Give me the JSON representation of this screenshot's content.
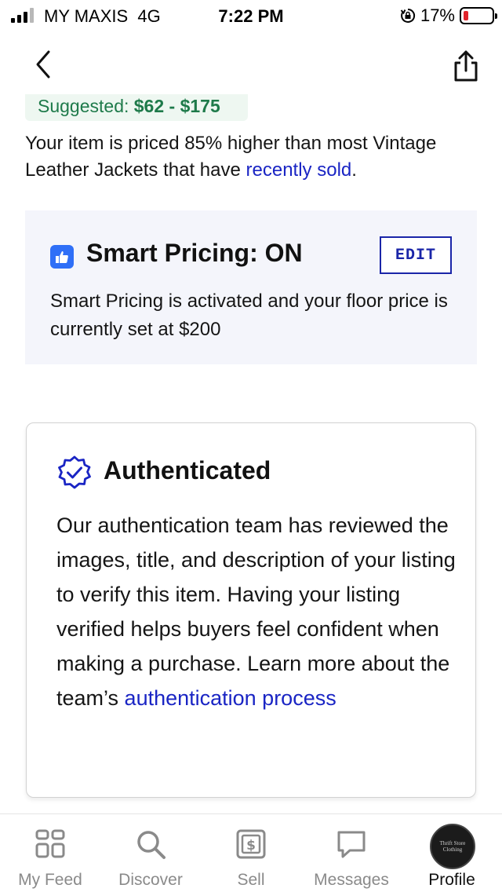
{
  "status_bar": {
    "carrier": "MY MAXIS",
    "network": "4G",
    "time": "7:22 PM",
    "battery": "17%",
    "battery_level": 0.17,
    "battery_color": "#e0242b"
  },
  "nav": {
    "back_icon": "chevron-left-icon",
    "share_icon": "share-icon"
  },
  "pricing": {
    "suggested_label": "Suggested: ",
    "suggested_range": "$62 - $175",
    "note_prefix": "Your item is priced 85% higher than most Vintage Leather Jackets that have ",
    "note_link": "recently sold",
    "note_suffix": "."
  },
  "smart_pricing": {
    "icon": "thumbs-up-icon",
    "title": "Smart Pricing: ON",
    "edit_label": "EDIT",
    "description": "Smart Pricing is activated and your floor price is currently set at $200"
  },
  "authenticated": {
    "icon": "verified-badge-icon",
    "title": "Authenticated",
    "body": "Our authentication team has reviewed the images, title, and description of your listing to verify this item. Having your listing verified helps buyers feel confident when making a purchase. Learn more about the team’s ",
    "link": "authentication process"
  },
  "tabbar": {
    "tabs": [
      {
        "label": "My Feed",
        "icon": "feed-grid-icon"
      },
      {
        "label": "Discover",
        "icon": "search-icon"
      },
      {
        "label": "Sell",
        "icon": "dollar-tag-icon"
      },
      {
        "label": "Messages",
        "icon": "chat-bubble-icon"
      },
      {
        "label": "Profile",
        "icon": "profile-avatar"
      }
    ],
    "active": "Profile",
    "avatar_text": [
      "Thrift Store",
      "Clothing"
    ]
  },
  "colors": {
    "accent": "#1a25c4",
    "success": "#1e7a4a",
    "smart_icon": "#2f6ff7"
  }
}
